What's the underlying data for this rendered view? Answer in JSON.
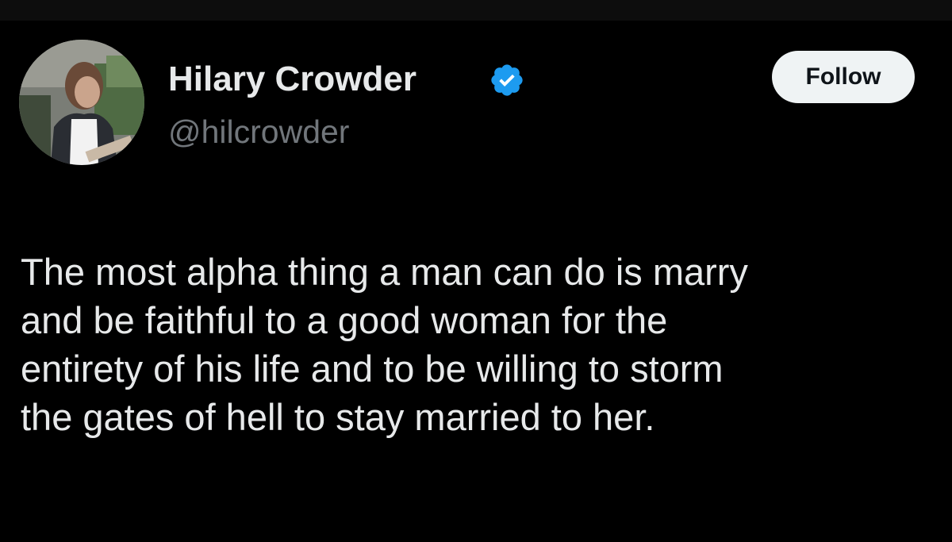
{
  "author": {
    "display_name": "Hilary Crowder",
    "handle": "@hilcrowder",
    "avatar_icon": "profile-photo",
    "verified_icon": "verified-badge-icon",
    "verified_color": "#1d9bf0"
  },
  "actions": {
    "follow_label": "Follow"
  },
  "tweet": {
    "lines": [
      "The most alpha thing a man can do is marry",
      "and be faithful to a good woman for the",
      "entirety of his life and to be willing to storm",
      "the gates of hell to stay married to her."
    ]
  },
  "colors": {
    "background": "#000000",
    "text": "#e7e9ea",
    "secondary_text": "#71767b",
    "button_bg": "#eff3f4",
    "button_text": "#0f1419"
  }
}
